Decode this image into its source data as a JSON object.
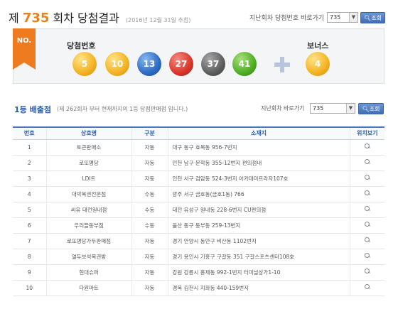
{
  "header": {
    "prefix": "제",
    "round": "735",
    "suffix": "회차 당첨결과",
    "date": "(2016년 12월 31일 추첨)",
    "go_label": "지난회차 당첨번호 바로가기",
    "select_value": "735",
    "search_label": "조회"
  },
  "result": {
    "ribbon": "NO.",
    "winning_label": "당첨번호",
    "bonus_label": "보너스",
    "numbers": [
      "5",
      "10",
      "13",
      "27",
      "37",
      "41"
    ],
    "bonus": "4"
  },
  "stores": {
    "title": "1등 배출점",
    "note": "(제 262회차 부터 현재까지의 1등 당첨판매점 입니다.)",
    "go_label": "지난회차 바로가기",
    "select_value": "735",
    "search_label": "조회",
    "columns": [
      "번호",
      "상호명",
      "구분",
      "소재지",
      "위치보기"
    ],
    "rows": [
      {
        "no": "1",
        "name": "토큰판매소",
        "type": "자동",
        "addr": "대구 동구 효목동 956-7번지"
      },
      {
        "no": "2",
        "name": "로또명당",
        "type": "자동",
        "addr": "인천 남구 문학동 355-12번지 편의점내"
      },
      {
        "no": "3",
        "name": "LDI트",
        "type": "자동",
        "addr": "인천 서구 검암동 524-3번지 아카데미프라자107호"
      },
      {
        "no": "4",
        "name": "대박복권전문점",
        "type": "수동",
        "addr": "광주 서구 금호동(금호1동) 766"
      },
      {
        "no": "5",
        "name": "씨유 대전원내점",
        "type": "수동",
        "addr": "대전 유성구 원내동 228-6번지 CU편의점"
      },
      {
        "no": "6",
        "name": "우리들동부점",
        "type": "수동",
        "addr": "울산 동구 동부동 259-13번지"
      },
      {
        "no": "7",
        "name": "로또명당가두판매점",
        "type": "자동",
        "addr": "경기 안양시 동안구 비산동 1102번지"
      },
      {
        "no": "8",
        "name": "열두보석복권방",
        "type": "자동",
        "addr": "경기 용인시 기흥구 구갈동 351 구갈스포츠센터108호"
      },
      {
        "no": "9",
        "name": "현대슈퍼",
        "type": "자동",
        "addr": "강원 강릉시 홍제동 992-1번지 터미널상가1-10"
      },
      {
        "no": "10",
        "name": "다원마트",
        "type": "자동",
        "addr": "경북 김천시 지좌동 440-159번지"
      }
    ]
  },
  "icons": {
    "location": "magnifier-icon",
    "bonus_plus": "plus-icon",
    "search": "magnifier-icon"
  },
  "colors": {
    "accent": "#e4841f",
    "link_blue": "#2b5eac",
    "button_blue": "#3f6fb6"
  }
}
